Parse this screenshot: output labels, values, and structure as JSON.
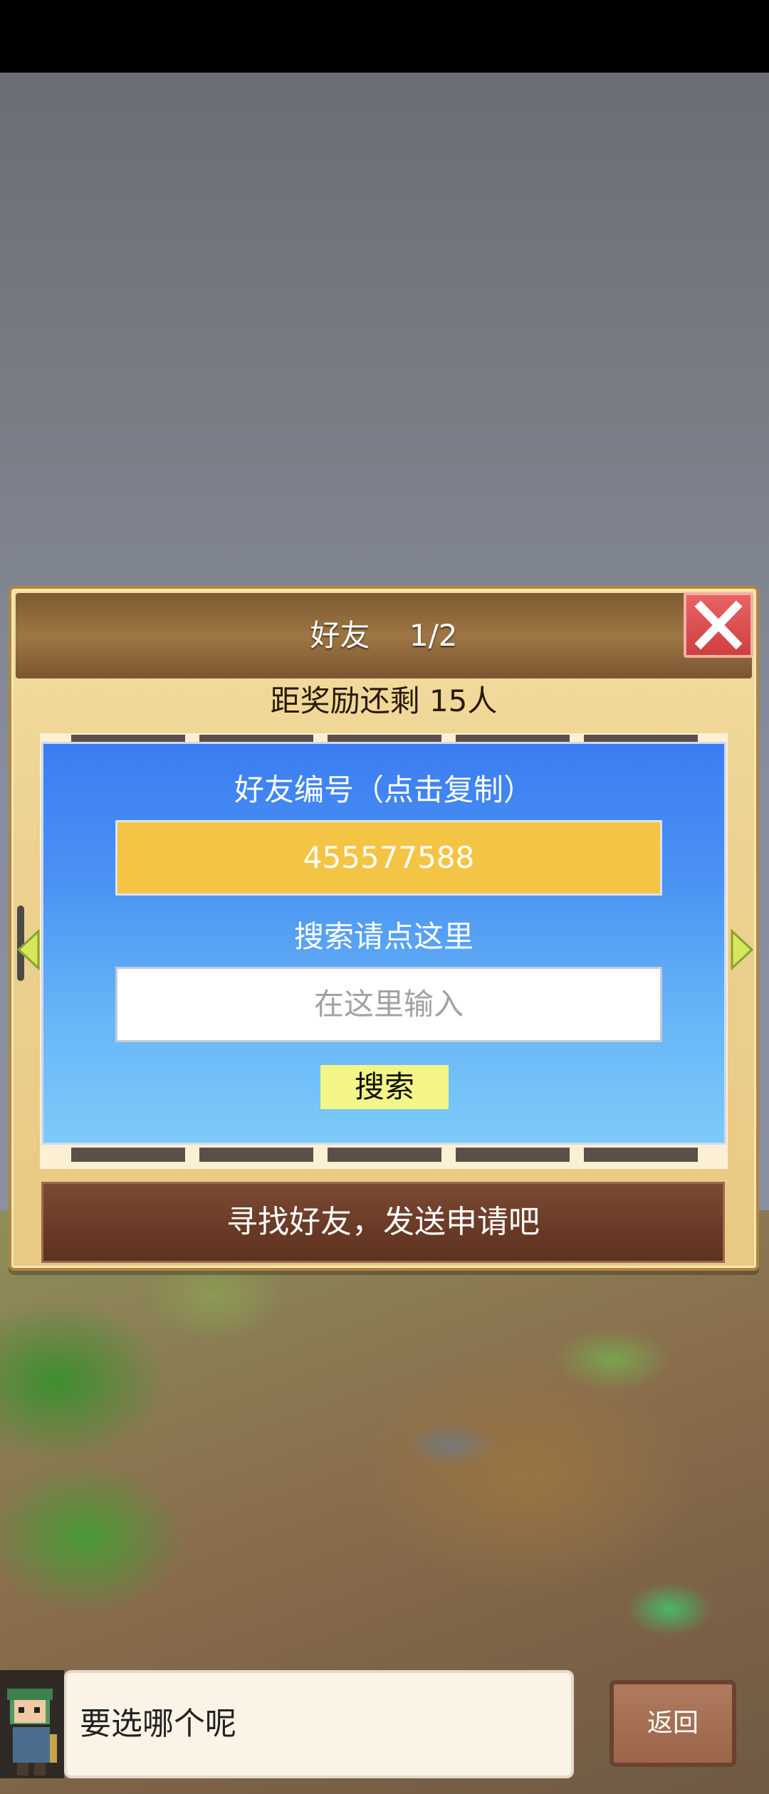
{
  "panel": {
    "title": "好友　 1/2",
    "reward_text": "距奖励还剩 15人"
  },
  "card": {
    "friend_id_label": "好友编号（点击复制）",
    "friend_id_value": "455577588",
    "search_label": "搜索请点这里",
    "search_placeholder": "在这里输入",
    "search_button": "搜索"
  },
  "bottom_bar": {
    "label": "寻找好友，发送申请吧"
  },
  "dialog": {
    "text": "要选哪个呢",
    "back_button": "返回"
  },
  "icons": {
    "close": "close-icon",
    "prev": "arrow-left-icon",
    "next": "arrow-right-icon",
    "avatar": "character-avatar"
  },
  "colors": {
    "accent_gold": "#f4c444",
    "card_blue": "#3b7df2",
    "search_button": "#f3f686",
    "close_red": "#cf4040"
  }
}
